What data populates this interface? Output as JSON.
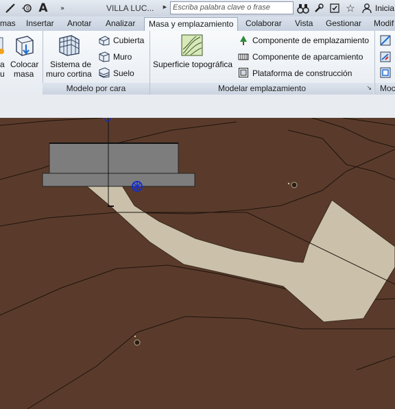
{
  "titlebar": {
    "title": "VILLA LUC...",
    "search_placeholder": "Escriba palabra clave o frase",
    "user_label": "Inicia",
    "icons": [
      "measure-icon",
      "tag-icon",
      "text-icon",
      "expand-icon",
      "binoculars-icon",
      "tools-icon",
      "settings-icon",
      "star-icon",
      "user-icon"
    ]
  },
  "tabs": [
    "mas",
    "Insertar",
    "Anotar",
    "Analizar",
    "Masa y emplazamiento",
    "Colaborar",
    "Vista",
    "Gestionar",
    "Modif"
  ],
  "ribbon": {
    "left_partial": {
      "line1": "a",
      "line2": "u"
    },
    "colocar_masa": {
      "line1": "Colocar",
      "line2": "masa"
    },
    "sistema_muro": {
      "line1": "Sistema de",
      "line2": "muro cortina"
    },
    "cubierta": "Cubierta",
    "muro": "Muro",
    "suelo": "Suelo",
    "superficie": "Superficie topográfica",
    "componente_emplazamiento": "Componente de emplazamiento",
    "componente_aparcamiento": "Componente de aparcamiento",
    "plataforma": "Plataforma de construcción",
    "panels": {
      "modelo_por_cara": "Modelo por cara",
      "modelar_emplazamiento": "Modelar emplazamiento",
      "modif_partial": "Moc"
    }
  },
  "colors": {
    "terrain": "#5a3b2b",
    "path": "#cbc1ab",
    "building": "#7d7d7d",
    "accent_blue": "#1530c9"
  }
}
